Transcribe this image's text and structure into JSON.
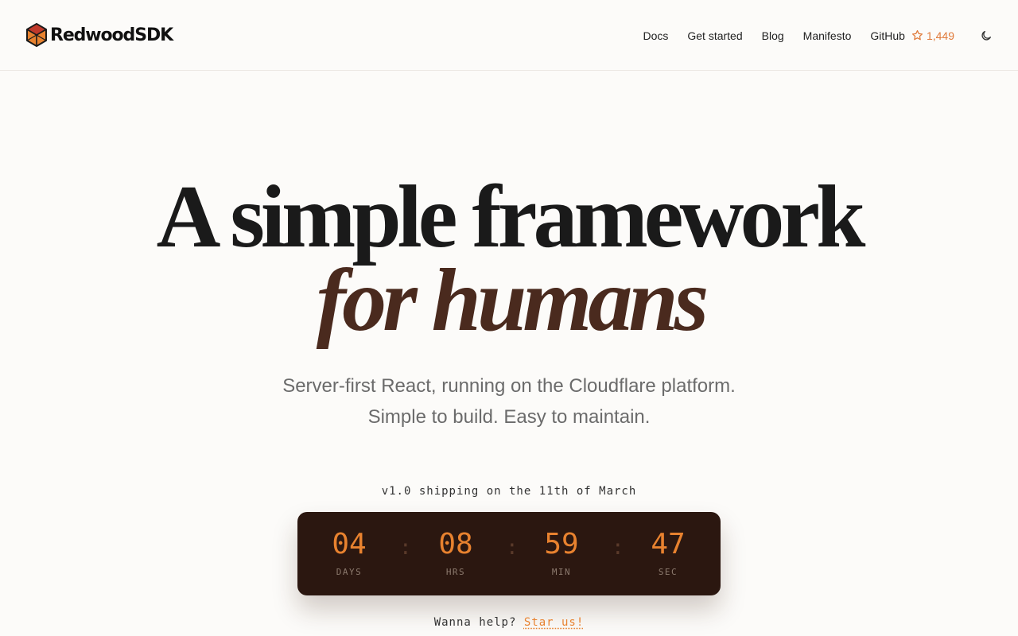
{
  "brand": {
    "name": "RedwoodSDK",
    "accent": "#e8822f",
    "logo_icon": "redwood-cube-icon"
  },
  "nav": {
    "items": [
      {
        "label": "Docs"
      },
      {
        "label": "Get started"
      },
      {
        "label": "Blog"
      },
      {
        "label": "Manifesto"
      }
    ],
    "github": {
      "label": "GitHub",
      "stars": "1,449",
      "icon": "star-icon"
    },
    "theme_toggle_icon": "moon-icon"
  },
  "hero": {
    "line1": "A simple framework",
    "line2": "for humans",
    "subtitle1": "Server-first React, running on the Cloudflare platform.",
    "subtitle2": "Simple to build. Easy to maintain."
  },
  "release": {
    "text": "v1.0 shipping on the 11th of March",
    "countdown": [
      {
        "value": "04",
        "label": "DAYS"
      },
      {
        "value": "08",
        "label": "HRS"
      },
      {
        "value": "59",
        "label": "MIN"
      },
      {
        "value": "47",
        "label": "SEC"
      }
    ],
    "separator": ":"
  },
  "cta": {
    "prefix": "Wanna help?",
    "link": "Star us!"
  },
  "colors": {
    "background": "#fcfbf9",
    "countdown_bg": "#2b1710",
    "title_dark": "#1a1a1a",
    "title_brown": "#4a2a1e",
    "subtitle": "#6b6b6b"
  }
}
